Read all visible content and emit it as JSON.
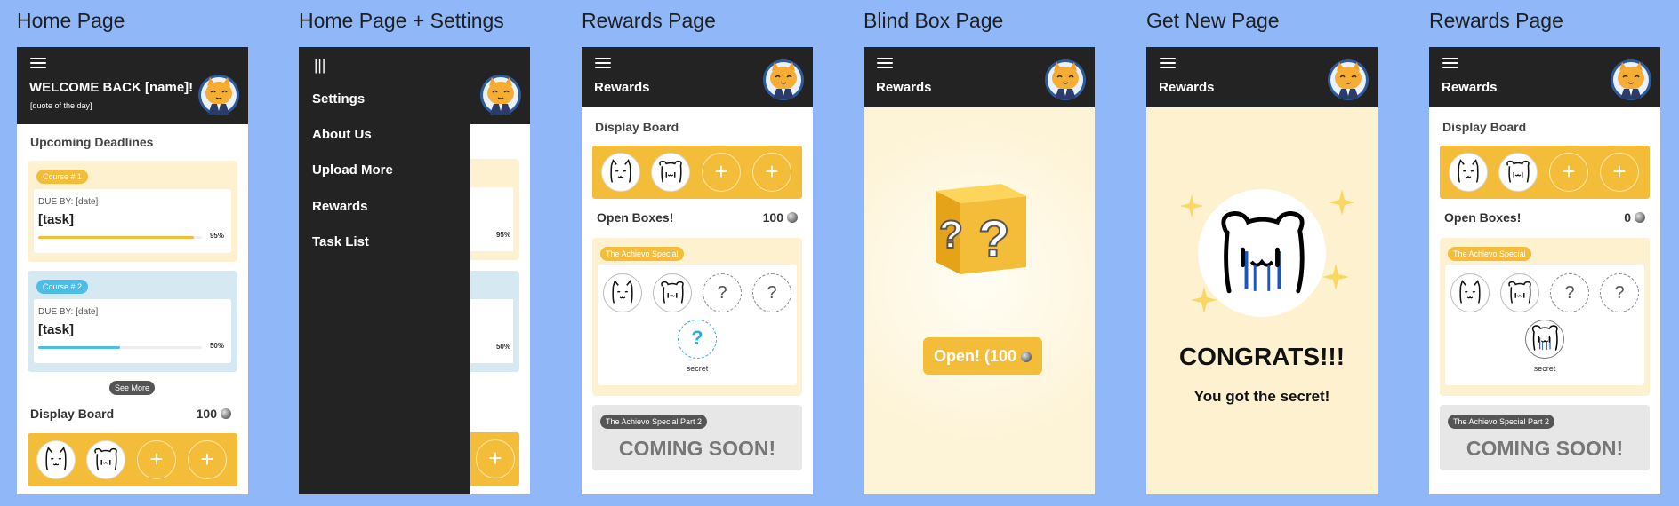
{
  "titles": [
    "Home Page",
    "Home Page + Settings",
    "Rewards Page",
    "Blind Box Page",
    "Get New Page",
    "Rewards Page"
  ],
  "home": {
    "welcome": "WELCOME BACK [name]!",
    "quote": "[quote of the day]",
    "upcoming": "Upcoming Deadlines",
    "courses": [
      {
        "tag": "Course # 1",
        "due": "DUE BY: [date]",
        "task": "[task]",
        "percent": "95%",
        "progress": 0.95,
        "color": "#f3bd3a",
        "bg": "#fdf1cf"
      },
      {
        "tag": "Course # 2",
        "due": "DUE BY: [date]",
        "task": "[task]",
        "percent": "50%",
        "progress": 0.5,
        "color": "#4dbde8",
        "bg": "#d6e8f2"
      }
    ],
    "see_more": "See More",
    "display_board": "Display Board",
    "coins": "100"
  },
  "settings": {
    "items": [
      "Settings",
      "About Us",
      "Upload More",
      "Rewards",
      "Task List"
    ],
    "peek_pcts": [
      "95%",
      "50%"
    ]
  },
  "rewards": {
    "header": "Rewards",
    "display_board": "Display Board",
    "open_boxes": "Open Boxes!",
    "coins": "100",
    "special_tag": "The Achievo Special",
    "secret_label": "secret",
    "coming_tag": "The Achievo Special Part 2",
    "coming_text": "COMING SOON!"
  },
  "blindbox": {
    "header": "Rewards",
    "open_btn": "Open! (100"
  },
  "getnew": {
    "header": "Rewards",
    "congrats": "CONGRATS!!!",
    "message": "You got the secret!"
  },
  "rewards2": {
    "header": "Rewards",
    "display_board": "Display Board",
    "open_boxes": "Open Boxes!",
    "coins": "0",
    "special_tag": "The Achievo Special",
    "secret_label": "secret",
    "coming_tag": "The Achievo Special Part 2",
    "coming_text": "COMING SOON!"
  },
  "colors": {
    "background": "#90b8f8",
    "header": "#232323",
    "accent": "#f3bd3a",
    "cream": "#fdf1cf"
  }
}
